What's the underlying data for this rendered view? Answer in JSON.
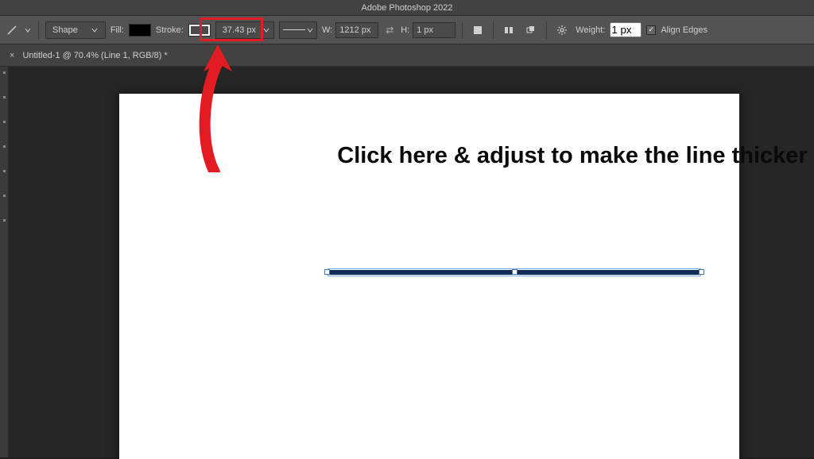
{
  "app": {
    "title": "Adobe Photoshop 2022"
  },
  "options": {
    "mode_label": "Shape",
    "fill_label": "Fill:",
    "stroke_label": "Stroke:",
    "stroke_width": "37.43 px",
    "w_label": "W:",
    "w_value": "1212 px",
    "h_label": "H:",
    "h_value": "1 px",
    "weight_label": "Weight:",
    "weight_value": "1 px",
    "align_edges_label": "Align Edges"
  },
  "tab": {
    "title": "Untitled-1 @ 70.4% (Line 1, RGB/8) *"
  },
  "annotation": {
    "text": "Click here & adjust to make the line thicker"
  },
  "colors": {
    "highlight": "#e31b23"
  }
}
